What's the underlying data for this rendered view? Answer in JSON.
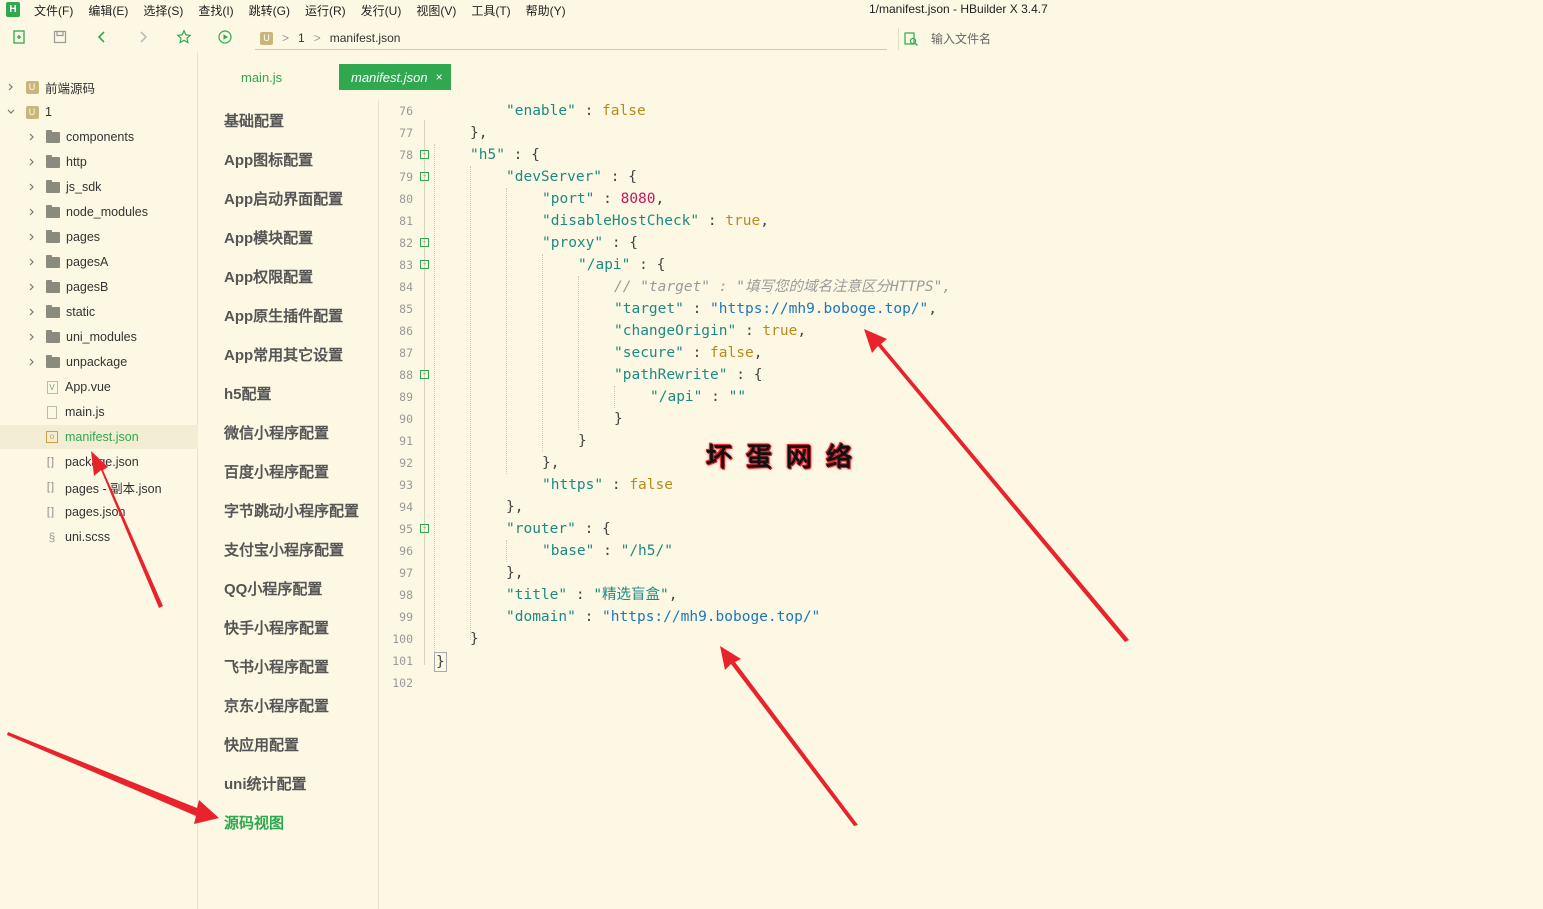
{
  "menubar": {
    "logo": "H",
    "items": [
      "文件(F)",
      "编辑(E)",
      "选择(S)",
      "查找(I)",
      "跳转(G)",
      "运行(R)",
      "发行(U)",
      "视图(V)",
      "工具(T)",
      "帮助(Y)"
    ],
    "window_title": "1/manifest.json - HBuilder X 3.4.7"
  },
  "toolbar": {
    "crumb_project_icon": "U",
    "crumb_project": "1",
    "crumb_sep": ">",
    "crumb_file": "manifest.json",
    "file_search_placeholder": "输入文件名",
    "icons": [
      "new-file-icon",
      "save-icon",
      "back-icon",
      "forward-icon",
      "star-icon",
      "run-icon",
      "file-search-icon"
    ]
  },
  "tree": {
    "items": [
      {
        "label": "前端源码",
        "kind": "project",
        "icon": "U"
      },
      {
        "label": "1",
        "kind": "project",
        "icon": "U"
      },
      {
        "label": "components",
        "kind": "folder"
      },
      {
        "label": "http",
        "kind": "folder"
      },
      {
        "label": "js_sdk",
        "kind": "folder"
      },
      {
        "label": "node_modules",
        "kind": "folder"
      },
      {
        "label": "pages",
        "kind": "folder"
      },
      {
        "label": "pagesA",
        "kind": "folder"
      },
      {
        "label": "pagesB",
        "kind": "folder"
      },
      {
        "label": "static",
        "kind": "folder"
      },
      {
        "label": "uni_modules",
        "kind": "folder"
      },
      {
        "label": "unpackage",
        "kind": "folder"
      },
      {
        "label": "App.vue",
        "kind": "vue",
        "icon": "V"
      },
      {
        "label": "main.js",
        "kind": "doc"
      },
      {
        "label": "manifest.json",
        "kind": "manifest",
        "icon": "o"
      },
      {
        "label": "package.json",
        "kind": "json",
        "icon": "[ ]"
      },
      {
        "label": "pages - 副本.json",
        "kind": "json",
        "icon": "[ ]"
      },
      {
        "label": "pages.json",
        "kind": "json",
        "icon": "[ ]"
      },
      {
        "label": "uni.scss",
        "kind": "scss",
        "icon": "§"
      }
    ],
    "selected": "manifest.json"
  },
  "tabs": {
    "main": "main.js",
    "manifest": "manifest.json",
    "close": "×"
  },
  "config_nav": {
    "items": [
      "基础配置",
      "App图标配置",
      "App启动界面配置",
      "App模块配置",
      "App权限配置",
      "App原生插件配置",
      "App常用其它设置",
      "h5配置",
      "微信小程序配置",
      "百度小程序配置",
      "字节跳动小程序配置",
      "支付宝小程序配置",
      "QQ小程序配置",
      "快手小程序配置",
      "飞书小程序配置",
      "京东小程序配置",
      "快应用配置",
      "uni统计配置",
      "源码视图"
    ],
    "active": "源码视图"
  },
  "code": {
    "line_numbers": [
      "76",
      "77",
      "78",
      "79",
      "80",
      "81",
      "82",
      "83",
      "84",
      "85",
      "86",
      "87",
      "88",
      "89",
      "90",
      "91",
      "92",
      "93",
      "94",
      "95",
      "96",
      "97",
      "98",
      "99",
      "100",
      "101",
      "102"
    ],
    "fold_marker": "-",
    "tokens": {
      "l76": [
        "\"enable\"",
        " : ",
        "false"
      ],
      "l77": [
        "},"
      ],
      "l78": [
        "\"h5\"",
        " : {"
      ],
      "l79": [
        "\"devServer\"",
        " : {"
      ],
      "l80": [
        "\"port\"",
        " : ",
        "8080",
        ","
      ],
      "l81": [
        "\"disableHostCheck\"",
        " : ",
        "true",
        ","
      ],
      "l82": [
        "\"proxy\"",
        " : {"
      ],
      "l83": [
        "\"/api\"",
        " : {"
      ],
      "l84": [
        "// \"target\" : \"填写您的域名注意区分HTTPS\","
      ],
      "l85": [
        "\"target\"",
        " : ",
        "\"https://mh9.boboge.top/\"",
        ","
      ],
      "l86": [
        "\"changeOrigin\"",
        " : ",
        "true",
        ","
      ],
      "l87": [
        "\"secure\"",
        " : ",
        "false",
        ","
      ],
      "l88": [
        "\"pathRewrite\"",
        " : {"
      ],
      "l89": [
        "\"/api\"",
        " : ",
        "\"\""
      ],
      "l90": [
        "}"
      ],
      "l91": [
        "}"
      ],
      "l92": [
        "},"
      ],
      "l93": [
        "\"https\"",
        " : ",
        "false"
      ],
      "l94": [
        "},"
      ],
      "l95": [
        "\"router\"",
        " : {"
      ],
      "l96": [
        "\"base\"",
        " : ",
        "\"/h5/\""
      ],
      "l97": [
        "},"
      ],
      "l98": [
        "\"title\"",
        " : ",
        "\"精选盲盒\"",
        ","
      ],
      "l99": [
        "\"domain\"",
        " : ",
        "\"https://mh9.boboge.top/\""
      ],
      "l100": [
        "}"
      ],
      "l101": [
        "}"
      ]
    }
  },
  "watermark": "坏蛋网络",
  "colors": {
    "accent": "#2fa84f",
    "background": "#fdf8e4",
    "arrow": "#e8232b"
  }
}
